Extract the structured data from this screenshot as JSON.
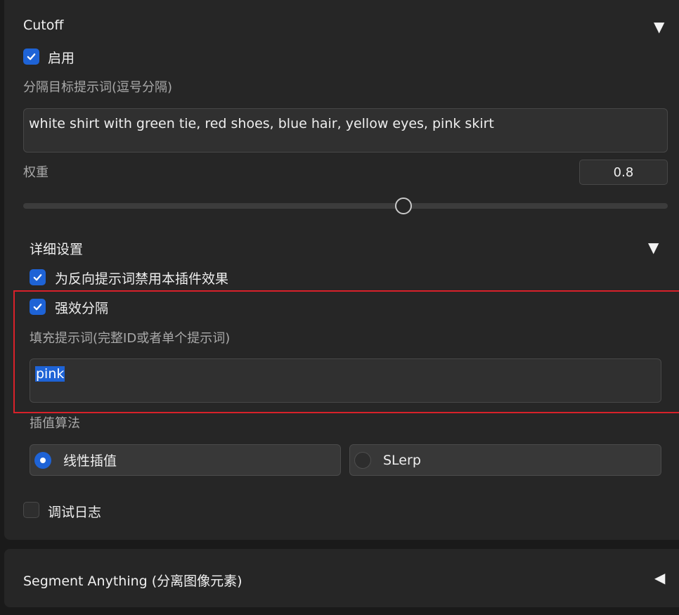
{
  "cutoff": {
    "title": "Cutoff",
    "collapse_icon": "triangle-down",
    "enable_label": "启用",
    "enable_checked": true,
    "targets_label": "分隔目标提示词(逗号分隔)",
    "targets_value": "white shirt with green tie, red shoes, blue hair, yellow eyes, pink skirt",
    "weight_label": "权重",
    "weight_value": "0.8",
    "weight_slider_fraction": 0.59
  },
  "details": {
    "title": "详细设置",
    "collapse_icon": "triangle-down",
    "disable_negative_label": "为反向提示词禁用本插件效果",
    "disable_negative_checked": true,
    "strong_label": "强效分隔",
    "strong_checked": true,
    "padding_label": "填充提示词(完整ID或者单个提示词)",
    "padding_value": "pink",
    "interp_label": "插值算法",
    "interp_options": [
      "线性插值",
      "SLerp"
    ],
    "interp_selected": "线性插值",
    "debug_label": "调试日志",
    "debug_checked": false
  },
  "segment": {
    "title": "Segment Anything (分离图像元素)",
    "expand_icon": "triangle-left"
  },
  "colors": {
    "accent": "#1e63d6",
    "highlight_border": "#d8212a",
    "panel_bg": "#262626"
  }
}
